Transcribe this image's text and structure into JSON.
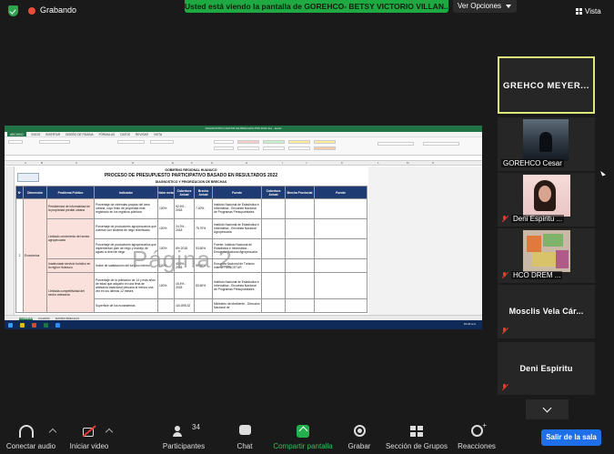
{
  "topbar": {
    "recording_label": "Grabando",
    "share_banner": "Usted está viendo la pantalla de GOREHCO- BETSY VICTORIO VILLAN...",
    "view_options": "Ver Opciones",
    "view_label": "Vista"
  },
  "shared_screen": {
    "excel_title": "DIAGNOSTICO MATRIZ DE BRECHAS PPR 2022.xlsx - Excel",
    "menu": [
      "ARCHIVO",
      "INICIO",
      "INSERTAR",
      "DISEÑO DE PÁGINA",
      "FÓRMULAS",
      "DATOS",
      "REVISAR",
      "VISTA"
    ],
    "columns": [
      "A",
      "B",
      "C",
      "D",
      "E",
      "F",
      "G",
      "H",
      "I",
      "J",
      "K",
      "L",
      "M",
      "N"
    ],
    "header_org": "GOBIERNO REGIONAL HUANUCO",
    "header_title": "PROCESO DE PRESUPUESTO PARTICIPATIVO BASADO EN RESULTADOS 2022",
    "header_subtitle": "DIAGNOSTICO Y PRIORIZACION DE BRECHAS",
    "table_headers": [
      "Nº",
      "Dimensión",
      "Problema Público",
      "Indicador",
      "Valor meta",
      "Cobertura Actual",
      "Brecha Actual",
      "Fuente",
      "Cobertura Actual",
      "Brecha Provincial",
      "Fuente"
    ],
    "dimension": "Económica",
    "row_num": "2",
    "rows": [
      {
        "problema": "Persistencia de informalidad de la propiedad predial urbana",
        "indicador": "Porcentaje de viviendas propias del área urbana, cuyo título de propiedad está registrado en los registros públicos",
        "meta": "100%",
        "cob": "92.6% - 2018",
        "brecha": "7.40%",
        "fuente": "Instituto Nacional de Estadística e Informática - Encuesta Nacional de Programas Presupuestales"
      },
      {
        "problema": "Limitado crecimiento del sector agropecuario",
        "indicador": "Porcentaje de productores agropecuarios que cuentan con sistema de riego tecnificado",
        "meta": "100%",
        "cob": "24.3% - 2018",
        "brecha": "75.70%",
        "fuente": "Instituto Nacional de Estadística e Informática - Encuesta Nacional Agropecuaria"
      },
      {
        "problema": "",
        "indicador": "Porcentaje de productores agropecuarios que implementan plan de riego y manejo de aguas a nivel de riego",
        "meta": "100%",
        "cob": "6% 2018",
        "brecha": "93.60%",
        "fuente": "Fuente: Instituto Nacional de Estadística e Informática - Encuesta Nacional Agropecuaria"
      },
      {
        "problema": "Inadecuado servicio turístico en la región Huánuco",
        "indicador": "Índice de satisfacción del turismo interno",
        "meta": "100%",
        "cob": "40.5% - 2018",
        "brecha": "59.50%",
        "fuente": "Encuesta Nacional de Turismo Interno - MINCETUR"
      },
      {
        "problema": "Limitada competitividad del sector artesanía",
        "indicador": "Porcentaje de la población de 14 y más años de edad que adquirió en una feria de artesanía tradicional peruana al menos una vez en los últimos 12 meses",
        "meta": "100%",
        "cob": "16.4% - 2018",
        "brecha": "83.60%",
        "fuente": "Instituto Nacional de Estadística e Informática - Encuesta Nacional de Programas Presupuestales"
      },
      {
        "problema": "",
        "indicador": "Superficie de los ecosistemas",
        "meta": "",
        "cob": "110,895.32",
        "brecha": "",
        "fuente": "Ministerio del Ambiente - Dirección Nacional de"
      }
    ],
    "watermark": "Página 2",
    "sheet_tabs": [
      "BRECHAS",
      "CUADRO",
      "MATRIZ BRECHAS"
    ],
    "taskbar_time": "10:24 a.m."
  },
  "participants": [
    {
      "name": "GREHCO MEYER...",
      "type": "name"
    },
    {
      "name": "GOREHCO Cesar",
      "type": "photo"
    },
    {
      "name": "Deni Espiritu ...",
      "type": "photo"
    },
    {
      "name": "HCO DREM ...",
      "type": "photo"
    },
    {
      "name": "Mosclis Vela Cár...",
      "type": "name"
    },
    {
      "name": "Deni Espiritu",
      "type": "name"
    }
  ],
  "toolbar": {
    "audio": "Conectar audio",
    "video": "Iniciar video",
    "participants": "Participantes",
    "participants_count": "34",
    "chat": "Chat",
    "share": "Compartir pantalla",
    "record": "Grabar",
    "breakout": "Sección de Grupos",
    "reactions": "Reacciones",
    "leave": "Salir de la sala"
  },
  "colors": {
    "banner_green": "#1fa942",
    "active_speaker_border": "#dfe67a",
    "leave_blue": "#1f6fe8",
    "mute_red": "#e63b2e",
    "excel_green": "#217346",
    "header_navy": "#1f3b73"
  }
}
